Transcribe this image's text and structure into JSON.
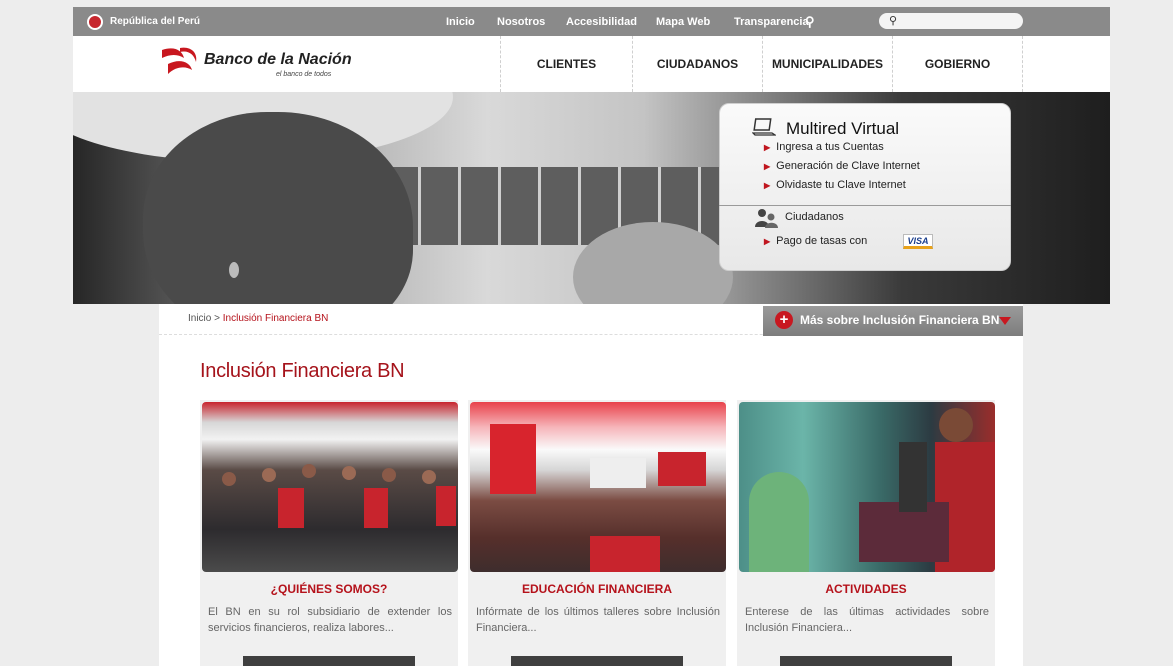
{
  "gov_bar": {
    "label": "República del Perú",
    "links": [
      "Inicio",
      "Nosotros",
      "Accesibilidad",
      "Mapa Web",
      "Transparencia"
    ],
    "search_placeholder": ""
  },
  "brand": {
    "name": "Banco de la Nación",
    "tagline": "el banco de todos",
    "color": "#b5121b"
  },
  "nav": [
    "CLIENTES",
    "CIUDADANOS",
    "MUNICIPALIDADES",
    "GOBIERNO"
  ],
  "multired": {
    "title": "Multired Virtual",
    "links": [
      "Ingresa a tus Cuentas",
      "Generación de Clave Internet",
      "Olvidaste tu Clave Internet"
    ],
    "citizens_label": "Ciudadanos",
    "payment_label": "Pago de tasas con",
    "visa_label": "VISA"
  },
  "breadcrumb": {
    "home": "Inicio",
    "separator": ">",
    "current": "Inclusión Financiera BN"
  },
  "more": {
    "label": "Más sobre Inclusión Financiera BN",
    "plus": "+"
  },
  "page": {
    "title": "Inclusión Financiera BN"
  },
  "cards": [
    {
      "title": "¿QUIÉNES SOMOS?",
      "description": "El BN en su rol subsidiario de extender los servicios financieros, realiza labores..."
    },
    {
      "title": "EDUCACIÓN FINANCIERA",
      "description": "Infórmate de los últimos talleres sobre Inclusión Financiera..."
    },
    {
      "title": "ACTIVIDADES",
      "description": "Enterese de las últimas actividades sobre Inclusión Financiera..."
    }
  ]
}
